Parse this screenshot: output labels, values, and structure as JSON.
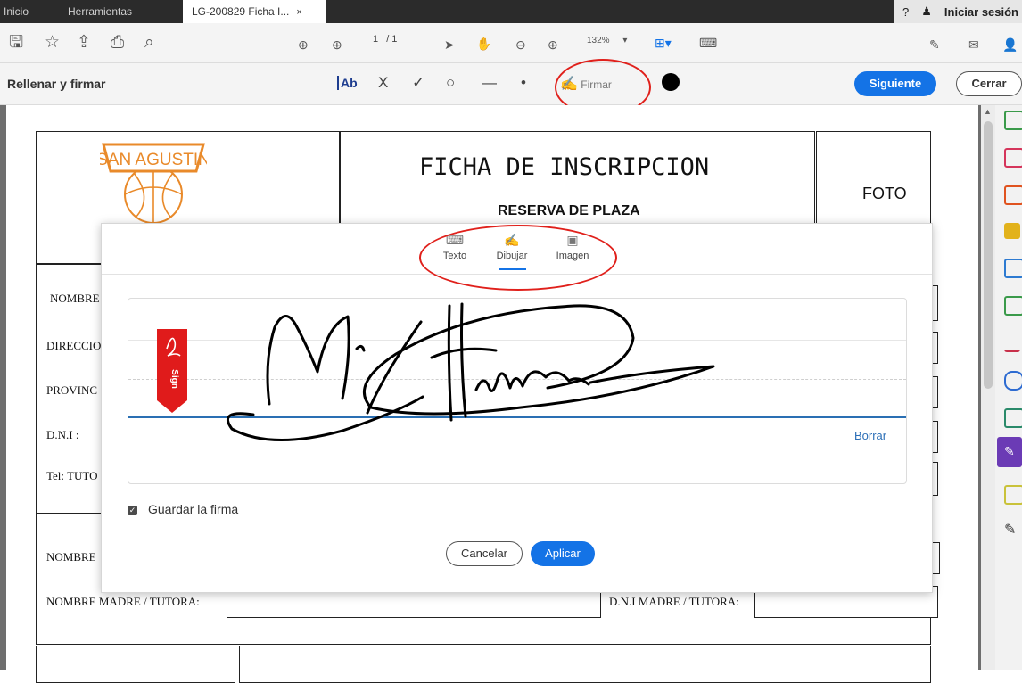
{
  "tabs": {
    "inicio": "Inicio",
    "herramientas": "Herramientas",
    "document": "LG-200829 Ficha I...",
    "close": "×"
  },
  "topright": {
    "help_icon": "?",
    "bell_icon": "♟",
    "signin": "Iniciar sesión"
  },
  "toolbar": {
    "page_current": "1",
    "page_total": "/ 1",
    "zoom": "132%",
    "zoom_arrow": "▾"
  },
  "fillbar": {
    "title": "Rellenar y firmar",
    "text_tool": "Ab",
    "cross": "X",
    "check": "✓",
    "circle": "○",
    "dash": "—",
    "dot": "•",
    "firmar": "Firmar",
    "siguiente": "Siguiente",
    "cerrar": "Cerrar"
  },
  "document": {
    "logo_text": "SAN AGUSTIN",
    "title": "FICHA DE INSCRIPCION",
    "subtitle": "RESERVA DE PLAZA",
    "foto": "FOTO",
    "labels": {
      "nombre": "NOMBRE",
      "direccion": "DIRECCIO",
      "provincia": "PROVINC",
      "dni": "D.N.I :",
      "tel": "Tel: TUTO",
      "nombre2": "NOMBRE",
      "madre": "NOMBRE MADRE / TUTORA:",
      "dni_madre": "D.N.I MADRE / TUTORA:"
    }
  },
  "modal": {
    "tabs": [
      "Texto",
      "Dibujar",
      "Imagen"
    ],
    "active_tab": "Dibujar",
    "ribbon_text": "Sign",
    "borrar": "Borrar",
    "save_label": "Guardar la firma",
    "save_checked": true,
    "cancel": "Cancelar",
    "apply": "Aplicar"
  },
  "colors": {
    "accent": "#1473e6",
    "annotation": "#e0201b",
    "ribbon": "#e01b1b",
    "logo_orange": "#e98a2a",
    "right_panel_selected": "#6b3bb5"
  }
}
